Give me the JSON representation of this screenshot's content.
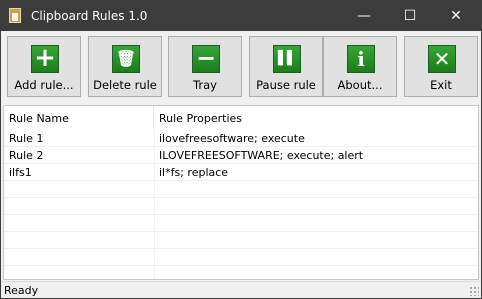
{
  "window": {
    "title": "Clipboard Rules 1.0",
    "controls": {
      "minimize": "—",
      "maximize": "☐",
      "close": "✕"
    }
  },
  "toolbar": {
    "buttons": [
      {
        "label": "Add rule...",
        "icon": "plus-icon",
        "glyph": "+"
      },
      {
        "label": "Delete rule",
        "icon": "trash-icon",
        "glyph": "🗑"
      },
      {
        "label": "Tray",
        "icon": "minus-icon",
        "glyph": "−"
      },
      {
        "label": "Pause rule",
        "icon": "pause-icon",
        "glyph": "▌▌"
      },
      {
        "label": "About...",
        "icon": "info-icon",
        "glyph": "i"
      },
      {
        "label": "Exit",
        "icon": "x-icon",
        "glyph": "✕"
      }
    ],
    "icon_color": "#2a8f2a"
  },
  "list": {
    "columns": [
      "Rule Name",
      "Rule Properties"
    ],
    "rows": [
      [
        "Rule 1",
        "ilovefreesoftware; execute"
      ],
      [
        "Rule 2",
        "ILOVEFREESOFTWARE; execute; alert"
      ],
      [
        "ilfs1",
        "il*fs; replace"
      ]
    ]
  },
  "status": {
    "text": "Ready"
  }
}
